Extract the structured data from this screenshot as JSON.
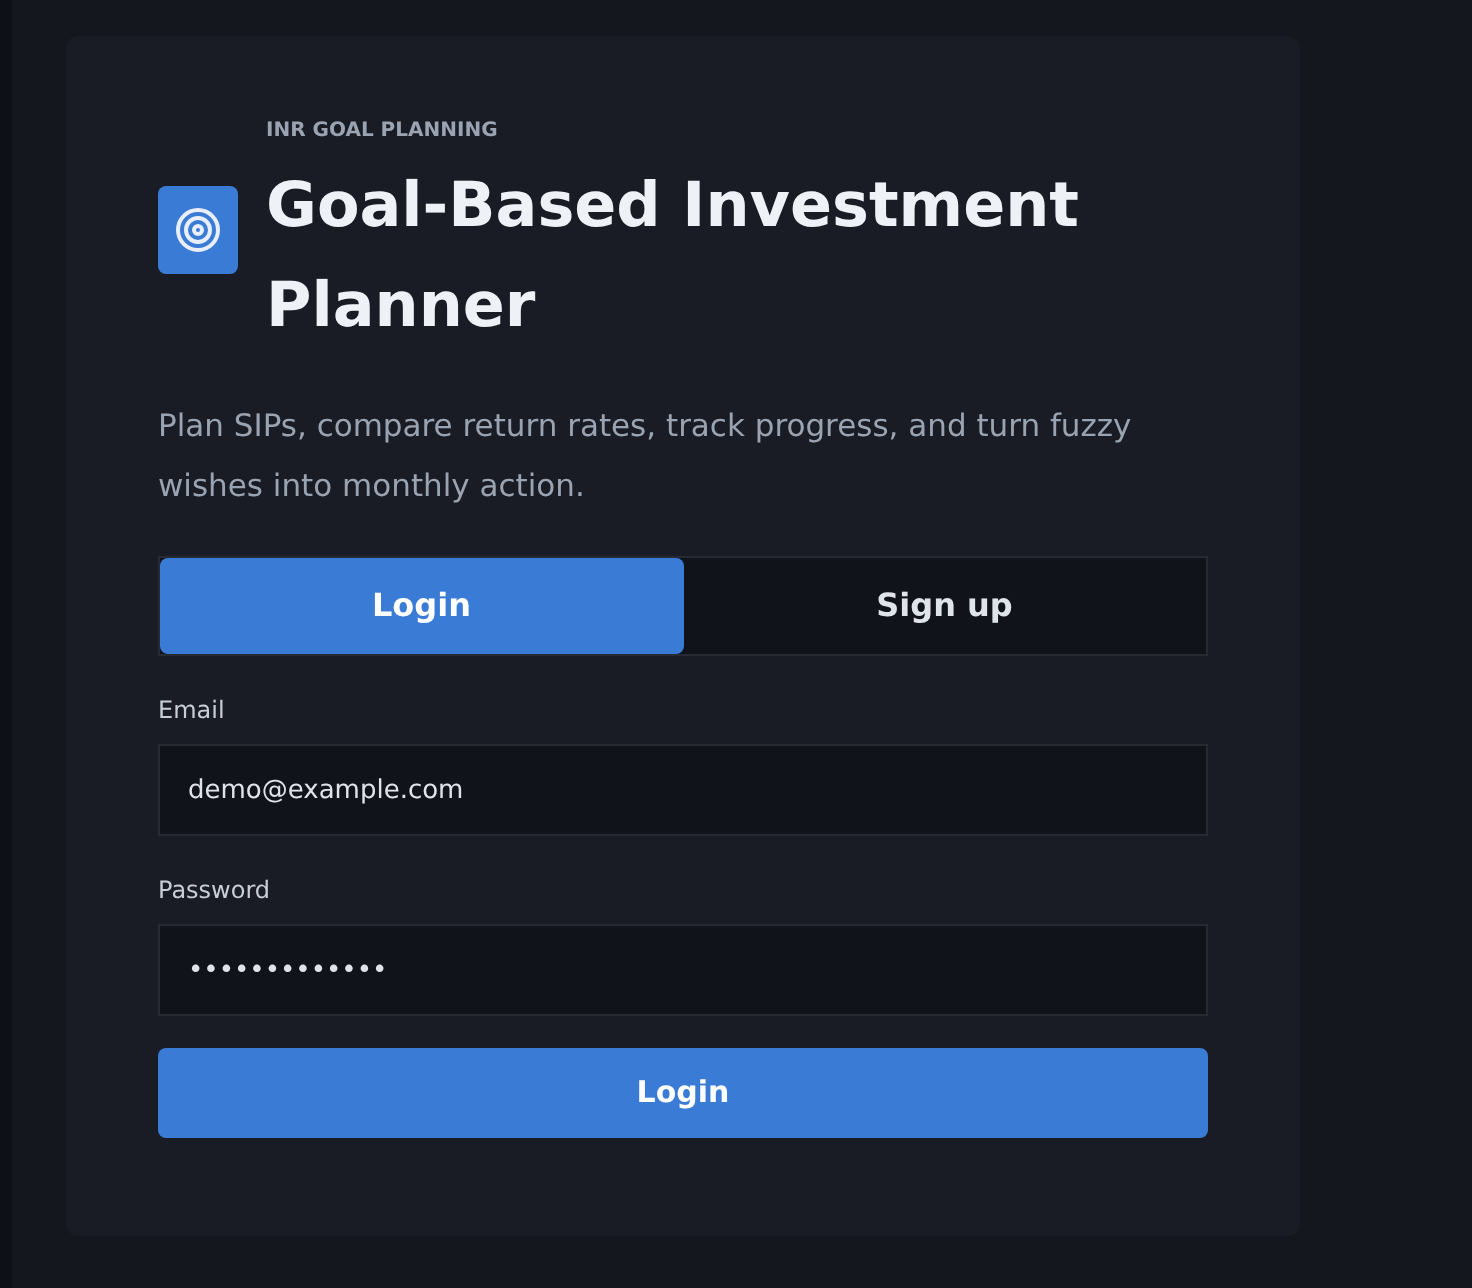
{
  "header": {
    "eyebrow": "INR GOAL PLANNING",
    "title": "Goal-Based Investment Planner",
    "description": "Plan SIPs, compare return rates, track progress, and turn fuzzy wishes into monthly action."
  },
  "tabs": [
    {
      "label": "Login",
      "selected": true
    },
    {
      "label": "Sign up",
      "selected": false
    }
  ],
  "fields": [
    {
      "label": "Email",
      "value": "demo@example.com"
    },
    {
      "label": "Password",
      "value": "•••••••••••••"
    }
  ],
  "submit": "Login"
}
